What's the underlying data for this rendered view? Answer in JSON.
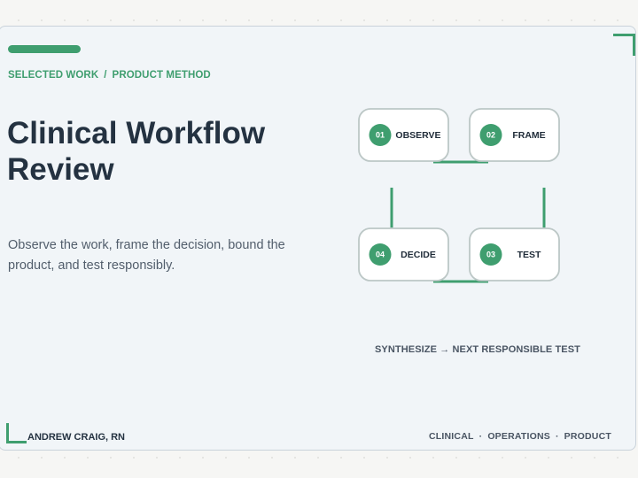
{
  "theme": {
    "accent": "#3f9e6f",
    "node_border": "#bcc7c6",
    "node_fill": "#ffffff"
  },
  "breadcrumb": {
    "section": "SELECTED WORK",
    "separator": "/",
    "page": "PRODUCT METHOD"
  },
  "title": {
    "line1": "Clinical Workflow",
    "line2": "Review"
  },
  "description": "Observe the work, frame the decision, bound the product, and test responsibly.",
  "diagram": {
    "nodes": [
      {
        "id": "observe",
        "number": "01",
        "label": "OBSERVE"
      },
      {
        "id": "frame",
        "number": "02",
        "label": "FRAME"
      },
      {
        "id": "test",
        "number": "03",
        "label": "TEST"
      },
      {
        "id": "decide",
        "number": "04",
        "label": "DECIDE"
      }
    ],
    "caption": "SYNTHESIZE → NEXT RESPONSIBLE TEST",
    "icons": {
      "step_badge": "numbered-circle-icon"
    }
  },
  "footer": {
    "author": "ANDREW CRAIG, RN",
    "tags": [
      "CLINICAL",
      "OPERATIONS",
      "PRODUCT"
    ],
    "tag_separator": "·"
  }
}
